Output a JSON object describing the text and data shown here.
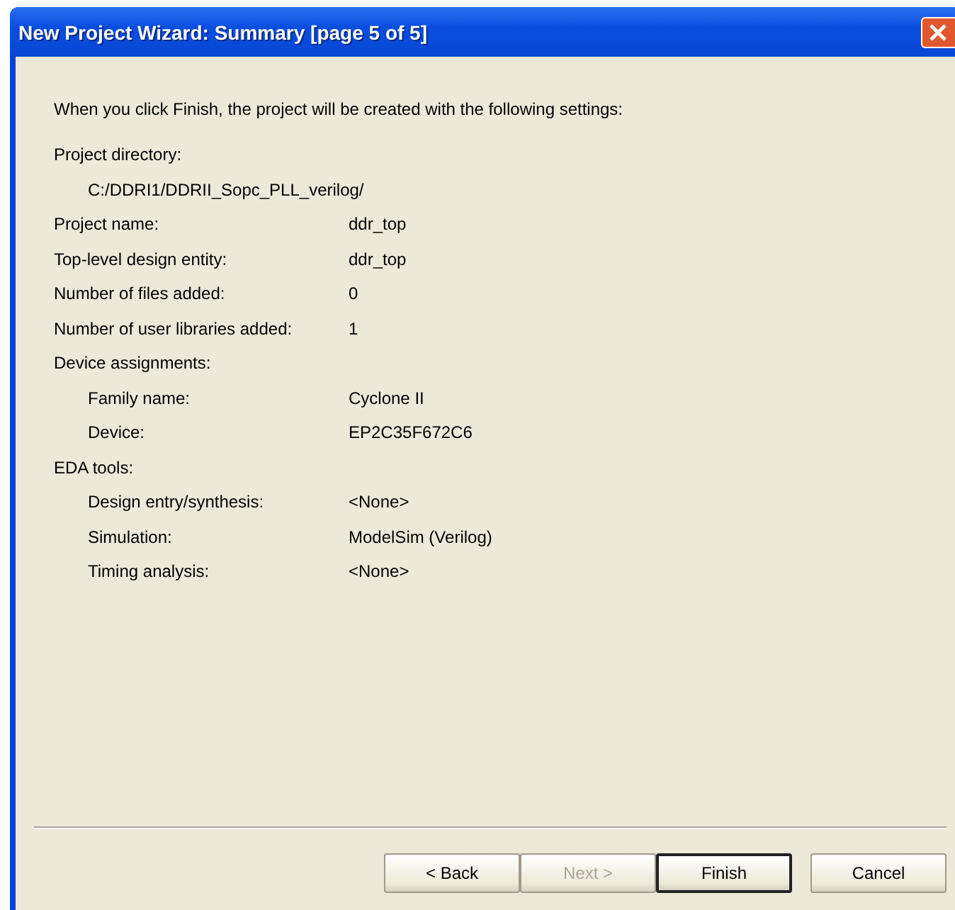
{
  "window": {
    "title": "New Project Wizard: Summary [page 5 of 5]"
  },
  "intro": "When you click Finish, the project will be created with the following settings:",
  "settings": [
    {
      "label": "Project directory:",
      "children": [
        {
          "value": "C:/DDRI1/DDRII_Sopc_PLL_verilog/"
        }
      ]
    },
    {
      "label": "Project name:",
      "value": "ddr_top"
    },
    {
      "label": "Top-level design entity:",
      "value": "ddr_top"
    },
    {
      "label": "Number of files added:",
      "value": "0"
    },
    {
      "label": "Number of user libraries added:",
      "value": "1"
    },
    {
      "label": "Device assignments:",
      "children": [
        {
          "label": "Family name:",
          "value": "Cyclone II"
        },
        {
          "label": "Device:",
          "value": "EP2C35F672C6"
        }
      ]
    },
    {
      "label": "EDA tools:",
      "children": [
        {
          "label": "Design entry/synthesis:",
          "value": "<None>"
        },
        {
          "label": "Simulation:",
          "value": "ModelSim (Verilog)"
        },
        {
          "label": "Timing analysis:",
          "value": "<None>"
        }
      ]
    }
  ],
  "buttons": [
    {
      "label": "< Back",
      "disabled": false,
      "default": false
    },
    {
      "label": "Next >",
      "disabled": true,
      "default": false
    },
    {
      "label": "Finish",
      "disabled": false,
      "default": true
    },
    {
      "label": "Cancel",
      "disabled": false,
      "default": false
    }
  ]
}
